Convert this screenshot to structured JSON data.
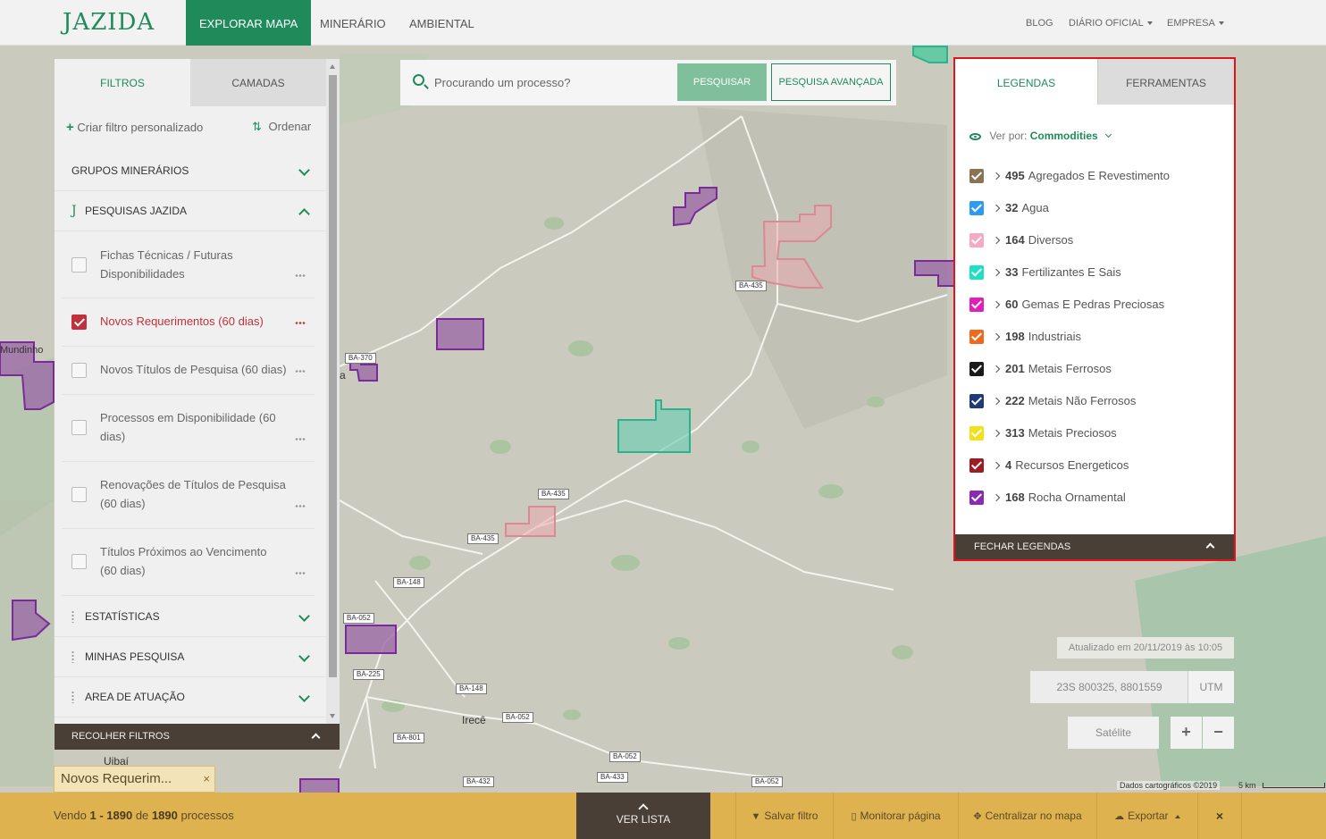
{
  "brand": {
    "logo_text": "JAZIDA",
    "primary_color": "#1f8b5a"
  },
  "nav": {
    "items": [
      {
        "label": "EXPLORAR MAPA",
        "active": true
      },
      {
        "label": "MINERÁRIO",
        "active": false
      },
      {
        "label": "AMBIENTAL",
        "active": false
      }
    ],
    "right": [
      {
        "label": "BLOG",
        "dropdown": false
      },
      {
        "label": "DIÁRIO OFICIAL",
        "dropdown": true
      },
      {
        "label": "EMPRESA",
        "dropdown": true
      }
    ]
  },
  "filters": {
    "tabs": [
      "FILTROS",
      "CAMADAS"
    ],
    "active_tab": "FILTROS",
    "create_label": "Criar filtro personalizado",
    "order_label": "Ordenar",
    "sections": {
      "grupos": "GRUPOS MINERÁRIOS",
      "pesquisas": "PESQUISAS JAZIDA",
      "estatisticas": "ESTATÍSTICAS",
      "minhas": "MINHAS PESQUISA",
      "area": "AREA DE ATUAÇÃO"
    },
    "items": [
      {
        "label": "Fichas Técnicas / Futuras Disponibilidades",
        "checked": false
      },
      {
        "label": "Novos Requerimentos (60 dias)",
        "checked": true
      },
      {
        "label": "Novos Títulos de Pesquisa (60 dias)",
        "checked": false
      },
      {
        "label": "Processos em Disponibilidade (60 dias)",
        "checked": false
      },
      {
        "label": "Renovações de Títulos de Pesquisa (60 dias)",
        "checked": false
      },
      {
        "label": "Títulos Próximos ao Vencimento (60 dias)",
        "checked": false
      }
    ],
    "collapse_label": "RECOLHER FILTROS"
  },
  "search": {
    "placeholder": "Procurando um processo?",
    "search_button": "PESQUISAR",
    "advanced_button": "PESQUISA AVANÇADA"
  },
  "legend": {
    "tabs": [
      "LEGENDAS",
      "FERRAMENTAS"
    ],
    "active_tab": "LEGENDAS",
    "view_by_label": "Ver por:",
    "view_by_value": "Commodities",
    "items": [
      {
        "count": "495",
        "label": "Agregados E Revestimento",
        "color": "#8b7355"
      },
      {
        "count": "32",
        "label": "Agua",
        "color": "#2e9bf0"
      },
      {
        "count": "164",
        "label": "Diversos",
        "color": "#f7a8c4"
      },
      {
        "count": "33",
        "label": "Fertilizantes E Sais",
        "color": "#1de0c4"
      },
      {
        "count": "60",
        "label": "Gemas E Pedras Preciosas",
        "color": "#e020b8"
      },
      {
        "count": "198",
        "label": "Industriais",
        "color": "#ef6a1f"
      },
      {
        "count": "201",
        "label": "Metais Ferrosos",
        "color": "#1a1a1a"
      },
      {
        "count": "222",
        "label": "Metais Não Ferrosos",
        "color": "#1f3a7a"
      },
      {
        "count": "313",
        "label": "Metais Preciosos",
        "color": "#f0e11a"
      },
      {
        "count": "4",
        "label": "Recursos Energeticos",
        "color": "#a01c24"
      },
      {
        "count": "168",
        "label": "Rocha Ornamental",
        "color": "#8a2ab0"
      }
    ],
    "close_label": "FECHAR LEGENDAS"
  },
  "map": {
    "updated_text": "Atualizado em 20/11/2019 às 10:05",
    "coordinates": "23S 800325, 8801559",
    "coord_system": "UTM",
    "layer_button": "Satélite",
    "zoom_in": "+",
    "zoom_out": "−",
    "attribution": "Dados cartográficos ©2019",
    "scale": "5 km",
    "road_labels": [
      "BA-435",
      "BA-370",
      "BA-435",
      "BA-435",
      "BA-148",
      "BA-052",
      "BA-225",
      "BA-148",
      "BA-052",
      "BA-801",
      "BA-052",
      "BA-432",
      "BA-433",
      "BA-052"
    ],
    "places": [
      "Mundinho",
      "a",
      "Irecê",
      "Uibaí"
    ]
  },
  "chip": {
    "label": "Novos Requerimentos (60 dias)",
    "display": "Novos Requerim...",
    "close": "×"
  },
  "bottom": {
    "results_prefix": "Vendo",
    "results_range": "1 - 1890",
    "results_mid": "de",
    "results_total": "1890",
    "results_suffix": "processos",
    "list_button": "VER LISTA",
    "actions": [
      "Salvar filtro",
      "Monitorar página",
      "Centralizar no mapa",
      "Exportar"
    ],
    "close": "×"
  }
}
